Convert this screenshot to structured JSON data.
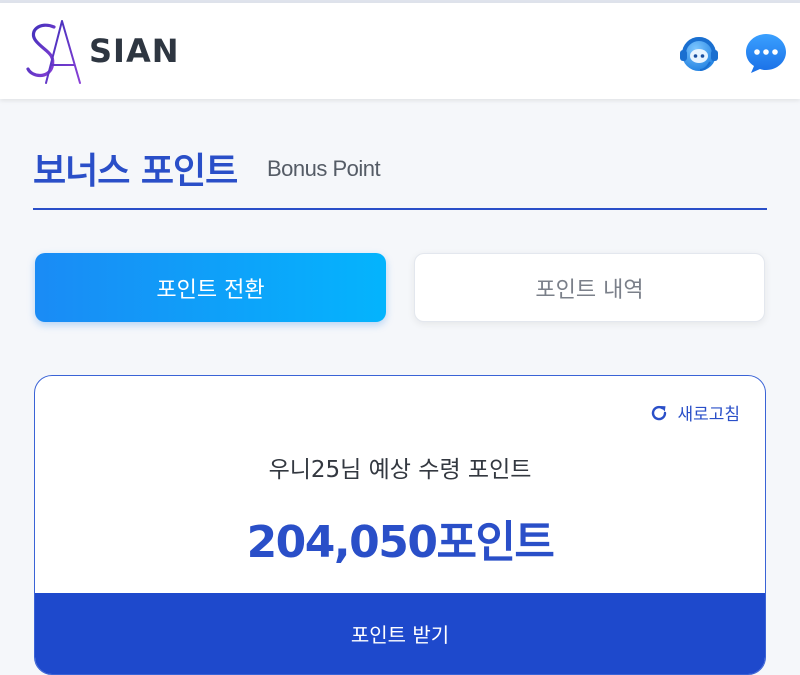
{
  "header": {
    "brand": "SIAN",
    "logo_icon": "sa-monogram-logo-icon",
    "agent_icon": "support-agent-icon",
    "chat_icon": "chat-bubble-icon",
    "brand_color": "#2a4fc8"
  },
  "page": {
    "title": "보너스 포인트",
    "subtitle": "Bonus Point"
  },
  "tabs": [
    {
      "label": "포인트 전환",
      "active": true
    },
    {
      "label": "포인트 내역",
      "active": false
    }
  ],
  "card": {
    "refresh_label": "새로고침",
    "refresh_icon": "refresh-icon",
    "expected_label": "우니25님 예상 수령 포인트",
    "points_value": "204,050포인트",
    "receive_button_label": "포인트 받기"
  }
}
